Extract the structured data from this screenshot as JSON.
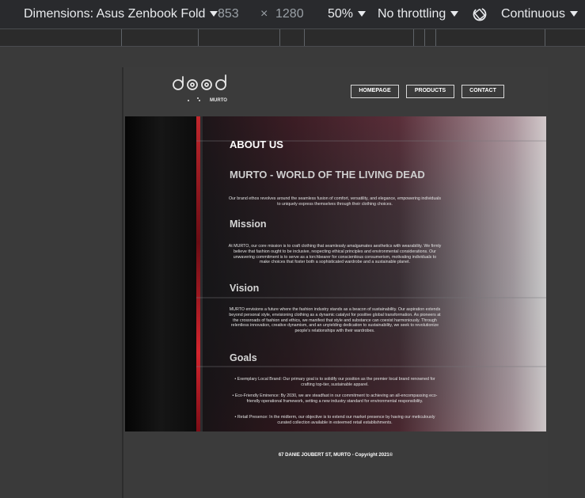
{
  "devtools": {
    "dimensions_label": "Dimensions: Asus Zenbook Fold",
    "width": "853",
    "times": "×",
    "height": "1280",
    "zoom": "50%",
    "throttling": "No throttling",
    "mode": "Continuous"
  },
  "site": {
    "logo_text": "MURTO",
    "nav": [
      "HOMEPAGE",
      "PRODUCTS",
      "CONTACT"
    ],
    "about_heading": "ABOUT US",
    "subtitle": "MURTO - WORLD OF THE LIVING DEAD",
    "intro": "Our brand ethos revolves around the seamless fusion of comfort, versatility, and elegance, empowering individuals to uniquely express themselves through their clothing choices.",
    "mission_heading": "Mission",
    "mission_text": "At MURTO, our core mission is to craft clothing that seamlessly amalgamates aesthetics with wearability. We firmly believe that fashion ought to be inclusive, respecting ethical principles and environmental considerations. Our unwavering commitment is to serve as a torchbearer for conscientious consumerism, motivating individuals to make choices that foster both a sophisticated wardrobe and a sustainable planet.",
    "vision_heading": "Vision",
    "vision_text": "MURTO envisions a future where the fashion industry stands as a beacon of sustainability. Our aspiration extends beyond personal style, envisioning clothing as a dynamic catalyst for positive global transformation. As pioneers at the crossroads of fashion and ethics, we manifest that style and substance can coexist harmoniously. Through relentless innovation, creative dynamism, and an unyielding dedication to sustainability, we seek to revolutionize people's relationships with their wardrobes.",
    "goals_heading": "Goals",
    "goals": [
      "• Exemplary Local Brand: Our primary goal is to solidify our position as the premier local brand renowned for crafting top-tier, sustainable apparel.",
      "• Eco-Friendly Eminence: By 2030, we are steadfast in our commitment to achieving an all-encompassing eco-friendly operational framework, setting a new industry standard for environmental responsibility.",
      "• Retail Presence: In the midterm, our objective is to extend our market presence by having our meticulously curated collection available in esteemed retail establishments."
    ],
    "footer": "67 DANIE JOUBERT ST, MURTO - Copyright 2021©"
  },
  "colors": {
    "accent_red": "#c1272d",
    "page_bg": "#3b3b3b",
    "toolbar_bg": "#292a2d"
  }
}
